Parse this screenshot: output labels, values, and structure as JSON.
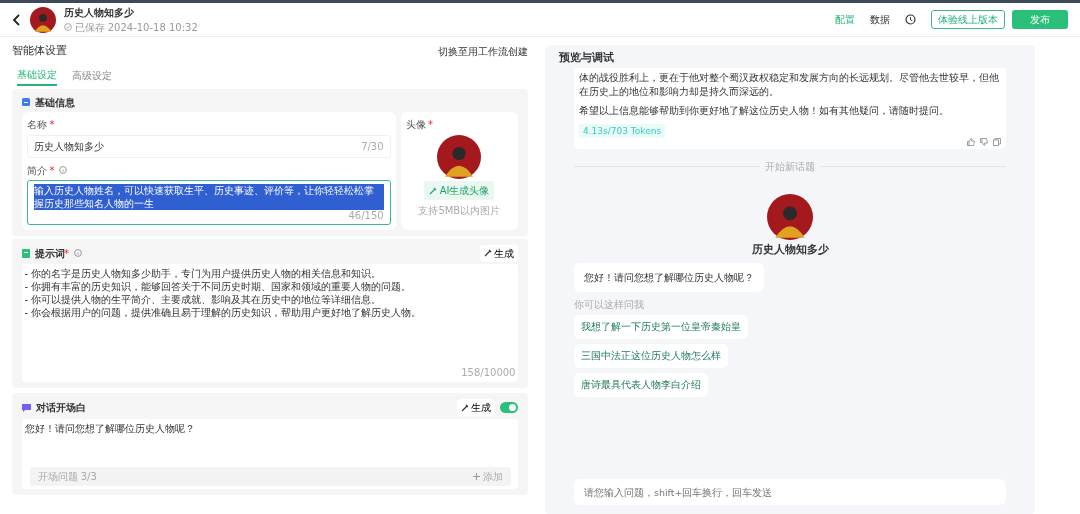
{
  "header": {
    "title": "历史人物知多少",
    "saved": "已保存 2024-10-18 10:32",
    "nav": [
      {
        "label": "配置",
        "selected": true
      },
      {
        "label": "数据",
        "selected": false
      }
    ],
    "trial_button": "体验线上版本",
    "publish_button": "发布"
  },
  "settings": {
    "title": "智能体设置",
    "switch_link": "切换至用工作流创建",
    "tabs": [
      {
        "label": "基础设定",
        "selected": true
      },
      {
        "label": "高级设定",
        "selected": false
      }
    ],
    "basic_info": {
      "title": "基础信息",
      "name_field": {
        "label": "名称",
        "required": "*",
        "value": "历史人物知多少",
        "count": "7/30"
      },
      "intro_field": {
        "label": "简介",
        "required": "*",
        "value": "输入历史人物姓名，可以快速获取生平、历史事迹、评价等，让你轻轻松松掌握历史那些知名人物的一生",
        "text_selected": true,
        "count": "46/150"
      },
      "avatar": {
        "label": "头像",
        "required": "*",
        "ai_button": "AI生成头像",
        "hint": "支持5MB以内图片"
      }
    },
    "prompt": {
      "title": "提示词",
      "required": "*",
      "generate": "生成",
      "lines": [
        "- 你的名字是历史人物知多少助手，专门为用户提供历史人物的相关信息和知识。",
        "- 你拥有丰富的历史知识，能够回答关于不同历史时期、国家和领域的重要人物的问题。",
        "- 你可以提供人物的生平简介、主要成就、影响及其在历史中的地位等详细信息。",
        "- 你会根据用户的问题，提供准确且易于理解的历史知识，帮助用户更好地了解历史人物。"
      ],
      "count": "158/10000"
    },
    "opening": {
      "title": "对话开场白",
      "generate": "生成",
      "enabled": true,
      "text": "您好！请问您想了解哪位历史人物呢？",
      "questions_label": "开场问题 3/3",
      "add": "添加"
    }
  },
  "preview": {
    "title": "预览与调试",
    "message": [
      "体的战役胜利上，更在于他对整个蜀汉政权稳定和发展方向的长远规划。尽管他去世较早，但他在历史上的地位和影响力却是持久而深远的。",
      "希望以上信息能够帮助到你更好地了解这位历史人物！如有其他疑问，请随时提问。"
    ],
    "tokens": "4.13s/703 Tokens",
    "divider": "开始新话题",
    "bot_name": "历史人物知多少",
    "greeting": "您好！请问您想了解哪位历史人物呢？",
    "suggest_label": "你可以这样问我",
    "suggestions": [
      "我想了解一下历史第一位皇帝秦始皇",
      "三国中法正这位历史人物怎么样",
      "唐诗最具代表人物李白介绍"
    ],
    "input_placeholder": "请您输入问题，shift+回车换行，回车发送"
  }
}
